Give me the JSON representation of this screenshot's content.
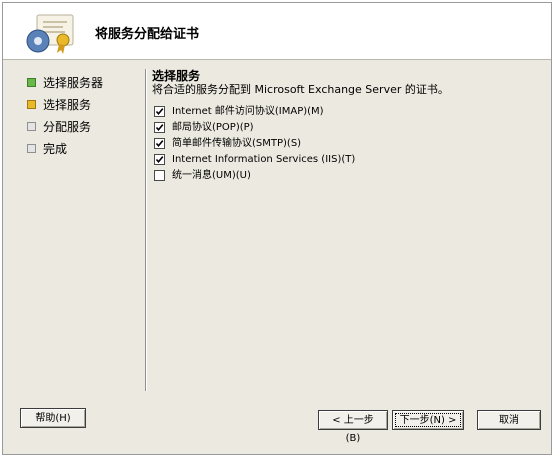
{
  "wizard": {
    "title": "将服务分配给证书"
  },
  "steps": [
    {
      "label": "选择服务器",
      "state": "done"
    },
    {
      "label": "选择服务",
      "state": "current"
    },
    {
      "label": "分配服务",
      "state": "pending"
    },
    {
      "label": "完成",
      "state": "pending"
    }
  ],
  "content": {
    "section_title": "选择服务",
    "description": "将合适的服务分配到 Microsoft Exchange Server 的证书。",
    "options": [
      {
        "label": "Internet 邮件访问协议(IMAP)(M)",
        "checked": true
      },
      {
        "label": "邮局协议(POP)(P)",
        "checked": true
      },
      {
        "label": "简单邮件传输协议(SMTP)(S)",
        "checked": true
      },
      {
        "label": "Internet Information Services (IIS)(T)",
        "checked": true
      },
      {
        "label": "统一消息(UM)(U)",
        "checked": false
      }
    ]
  },
  "buttons": {
    "help": "帮助(H)",
    "back": "< 上一步(B)",
    "next": "下一步(N) >",
    "cancel": "取消"
  },
  "colors": {
    "step_done": "#6ab84a",
    "step_current": "#e9b929",
    "step_pending": "#e4e4e4"
  },
  "icons": {
    "header": "certificate-gear-icon"
  }
}
